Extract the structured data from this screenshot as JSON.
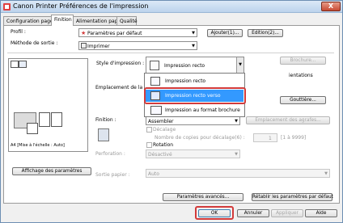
{
  "window": {
    "title": "Canon Printer Préférences de l'impression",
    "close_label": "X"
  },
  "tabs": [
    {
      "label": "Configuration page"
    },
    {
      "label": "Finition"
    },
    {
      "label": "Alimentation papier"
    },
    {
      "label": "Qualité"
    }
  ],
  "profile": {
    "label": "Profil :",
    "value": "Paramètres par défaut",
    "add_label": "Ajouter(1)...",
    "edit_label": "Edition(2)..."
  },
  "output_method": {
    "label": "Méthode de sortie :",
    "value": "Imprimer"
  },
  "print_style": {
    "label": "Style d'impression :",
    "value": "Impression recto",
    "options": [
      {
        "label": "Impression recto"
      },
      {
        "label": "Impression recto verso"
      },
      {
        "label": "Impression au format brochure"
      }
    ],
    "brochure_label": "Brochure...",
    "orientations_text": "ientations"
  },
  "binding": {
    "label": "Emplacement de la reli",
    "gutter_label": "Gouttière..."
  },
  "finishing": {
    "label": "Finition :",
    "value": "Assembler",
    "staple_location_label": "Emplacement des agrafes...",
    "offset_label": "Décalage",
    "offset_copies_label": "Nombre de copies pour décalage(6) :",
    "offset_copies_value": "1",
    "offset_range": "[1 à 9999]",
    "rotation_label": "Rotation"
  },
  "perforation": {
    "label": "Perforation :",
    "value": "Désactivé"
  },
  "paper_output": {
    "label": "Sortie papier :",
    "value": "Auto"
  },
  "preview": {
    "caption": "A4 [Mise à l'échelle : Auto]",
    "show_settings_label": "Affichage des paramètres"
  },
  "bottom_buttons": {
    "advanced_label": "Paramètres avancés...",
    "restore_label": "Rétablir les paramètres par défaut",
    "ok_label": "OK",
    "cancel_label": "Annuler",
    "apply_label": "Appliquer",
    "help_label": "Aide"
  }
}
